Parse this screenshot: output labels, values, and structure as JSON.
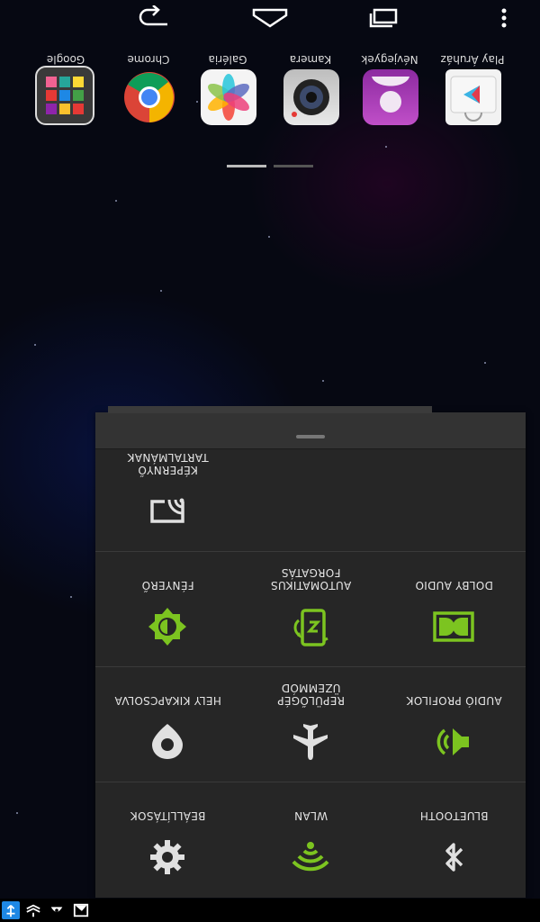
{
  "status_bar": {
    "icons": [
      "image-icon",
      "notification-dismissed-icon",
      "stack-icon",
      "usb-debug-icon"
    ]
  },
  "quick_settings": {
    "rows": [
      [
        {
          "label": "BLUETOOTH",
          "icon": "bluetooth-icon",
          "active": false
        },
        {
          "label": "WLAN",
          "icon": "wifi-icon",
          "active": true
        },
        {
          "label": "BEÁLLÍTÁSOK",
          "icon": "gear-icon",
          "active": false
        }
      ],
      [
        {
          "label": "AUDIÓ PROFILOK",
          "icon": "speaker-icon",
          "active": true
        },
        {
          "label_line1": "REPÜLŐGÉP",
          "label_line2": "ÜZEMMÓD",
          "icon": "airplane-icon",
          "active": false
        },
        {
          "label": "HELY KIKAPCSOLVA",
          "icon": "location-icon",
          "active": false
        }
      ],
      [
        {
          "label": "DOLBY AUDIO",
          "icon": "dolby-icon",
          "active": true
        },
        {
          "label_line1": "AUTOMATIKUS",
          "label_line2": "FORGATÁS",
          "icon": "auto-rotate-icon",
          "active": true
        },
        {
          "label": "FÉNYERŐ",
          "icon": "brightness-icon",
          "active": true
        }
      ],
      [
        {
          "label_line1": "KÉPERNYŐ",
          "label_line2": "TARTALMÁNAK",
          "icon": "cast-screen-icon",
          "active": false
        }
      ]
    ]
  },
  "dock": {
    "apps": [
      {
        "label": "Play Áruház",
        "icon": "play-store-icon"
      },
      {
        "label": "Névjegyek",
        "icon": "contacts-icon"
      },
      {
        "label": "Kamera",
        "icon": "camera-icon"
      },
      {
        "label": "Galéria",
        "icon": "gallery-icon"
      },
      {
        "label": "Chrome",
        "icon": "chrome-icon"
      },
      {
        "label": "Google",
        "icon": "google-folder-icon"
      }
    ]
  },
  "colors": {
    "accent_green": "#7cc420",
    "inactive_icon": "#e0e0e0",
    "panel_bg": "#262626"
  }
}
